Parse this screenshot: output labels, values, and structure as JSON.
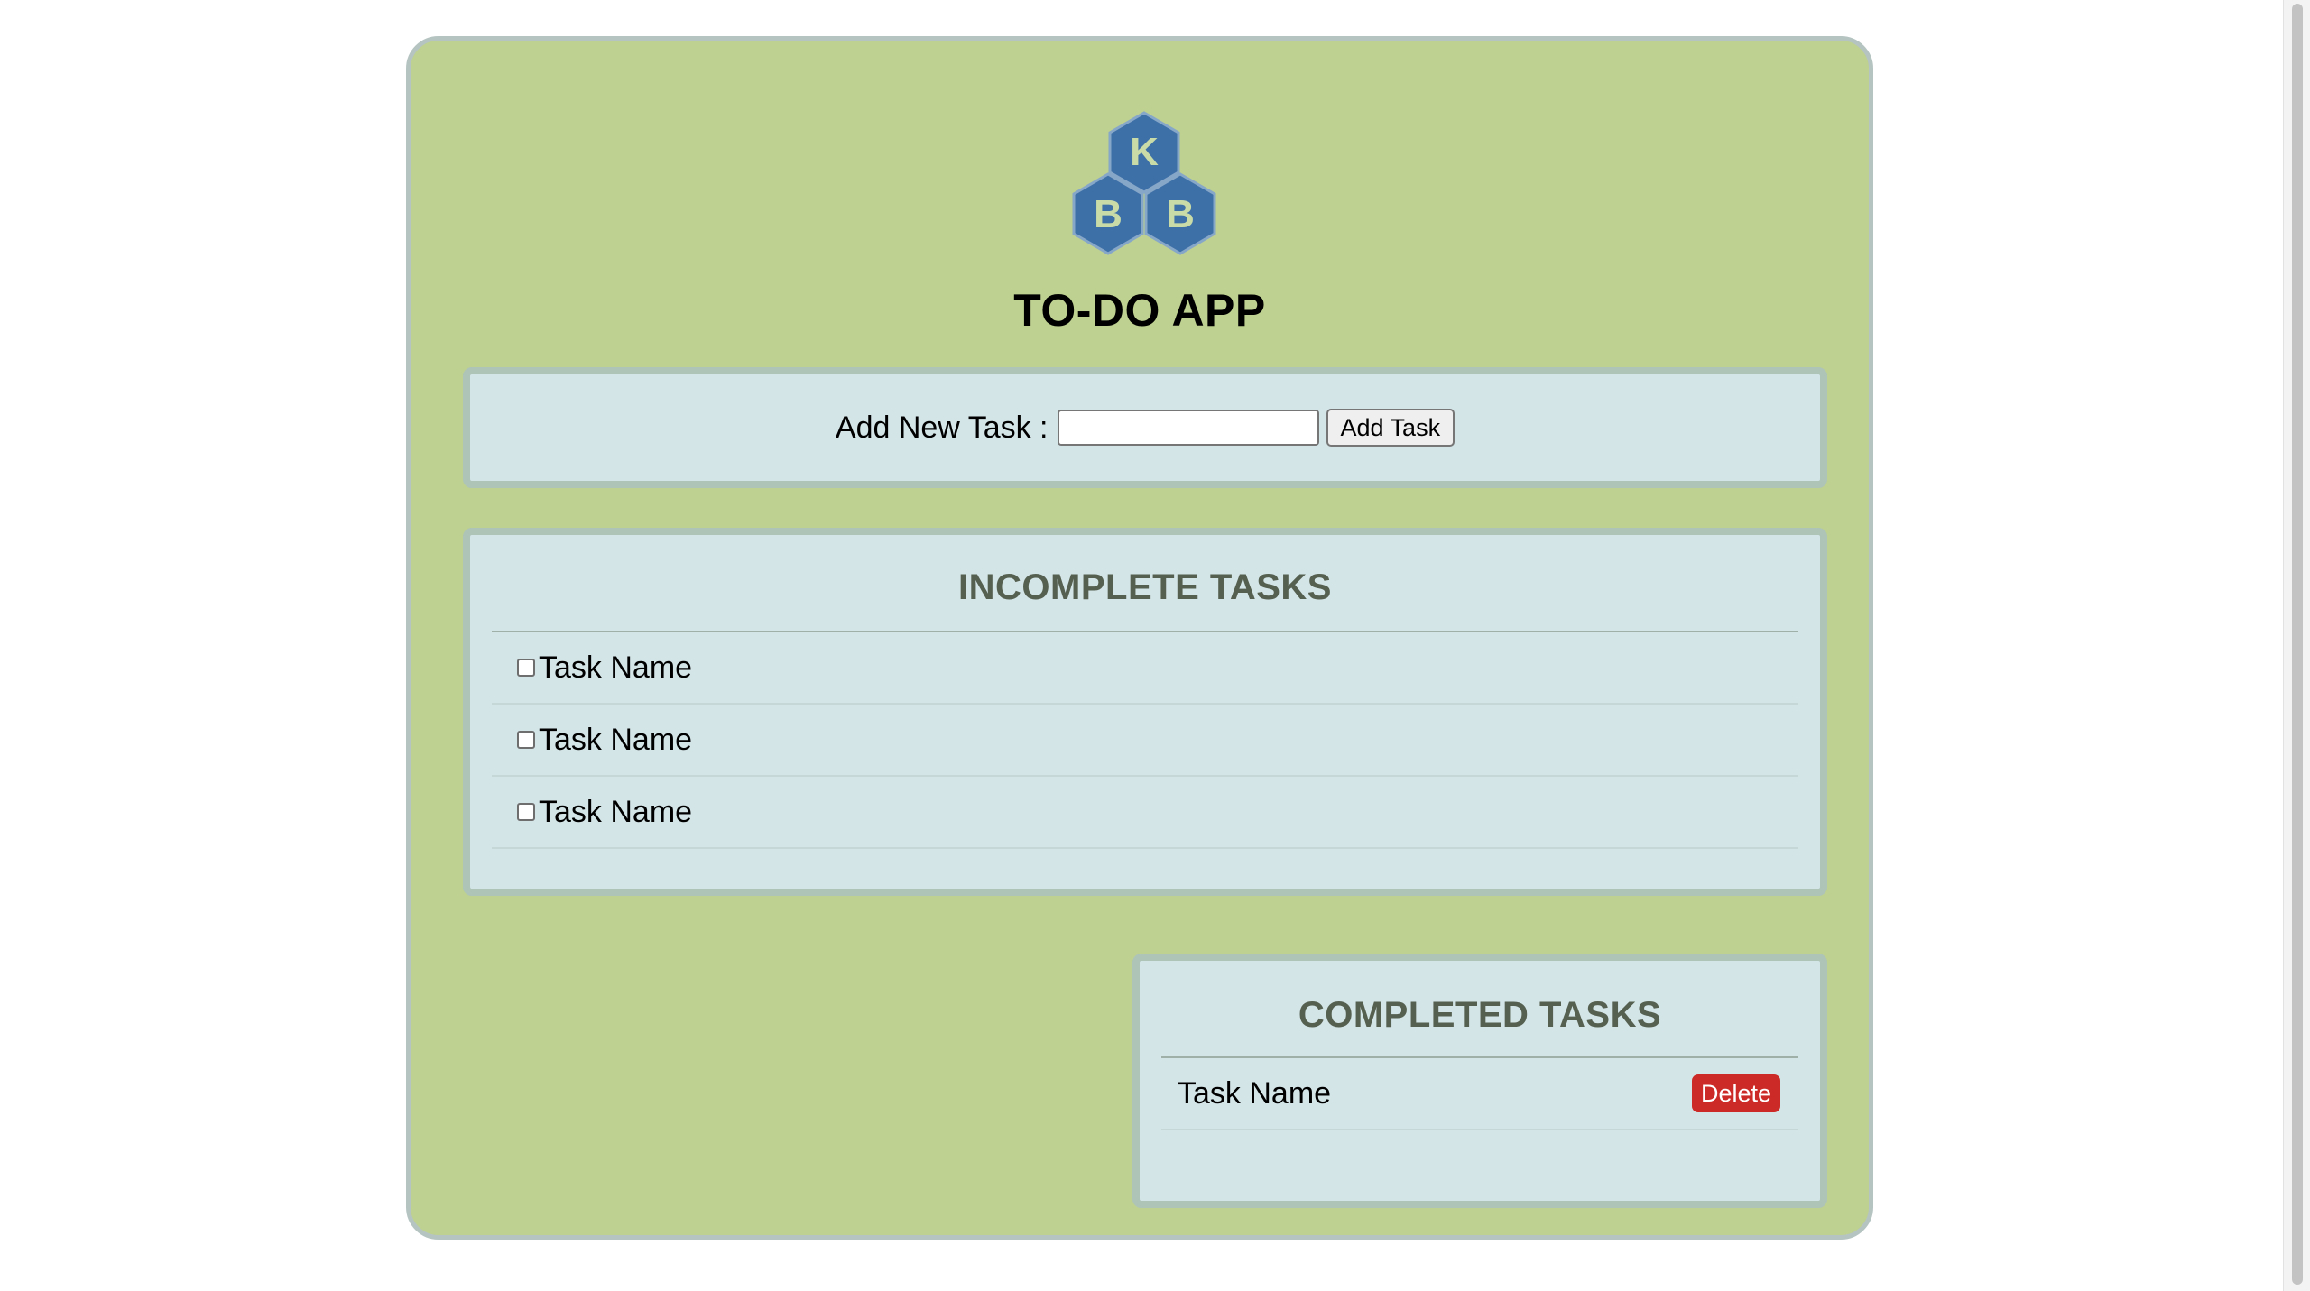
{
  "app": {
    "logo_letters": [
      "K",
      "B",
      "B"
    ],
    "title": "TO-DO APP"
  },
  "add_task": {
    "label": "Add New Task :",
    "input_value": "",
    "button_label": "Add Task"
  },
  "incomplete": {
    "title": "INCOMPLETE TASKS",
    "tasks": [
      {
        "name": "Task Name",
        "checked": false
      },
      {
        "name": "Task Name",
        "checked": false
      },
      {
        "name": "Task Name",
        "checked": false
      }
    ]
  },
  "completed": {
    "title": "COMPLETED TASKS",
    "tasks": [
      {
        "name": "Task Name",
        "delete_label": "Delete"
      }
    ]
  },
  "colors": {
    "card_background": "#bed190",
    "panel_background": "#d4e5e8",
    "logo_blue": "#3e70a8",
    "delete_red": "#cc2a26",
    "section_title": "#556050"
  }
}
